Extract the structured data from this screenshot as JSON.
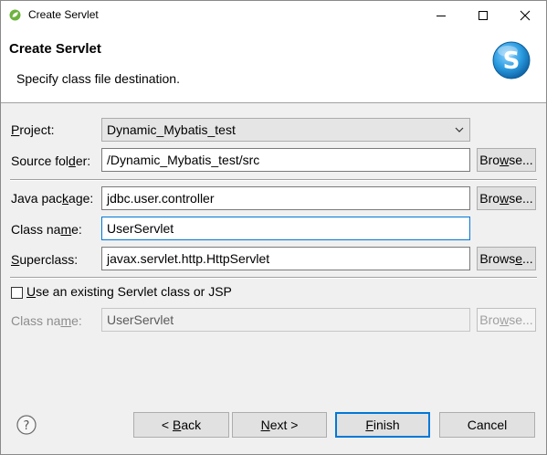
{
  "window": {
    "title": "Create Servlet",
    "minimize_icon": "minimize-icon",
    "maximize_icon": "maximize-icon",
    "close_icon": "close-icon"
  },
  "banner": {
    "title": "Create Servlet",
    "description": "Specify class file destination.",
    "logo_icon": "spring-s-logo"
  },
  "form": {
    "project": {
      "label_pre": "",
      "label_mn": "P",
      "label_post": "roject:",
      "value": "Dynamic_Mybatis_test"
    },
    "source_folder": {
      "label_pre": "Source fol",
      "label_mn": "d",
      "label_post": "er:",
      "value": "/Dynamic_Mybatis_test/src",
      "browse_pre": "Bro",
      "browse_mn": "w",
      "browse_post": "se..."
    },
    "java_package": {
      "label_pre": "Java pac",
      "label_mn": "k",
      "label_post": "age:",
      "value": "jdbc.user.controller",
      "browse_pre": "Bro",
      "browse_mn": "w",
      "browse_post": "se..."
    },
    "class_name": {
      "label_pre": "Class na",
      "label_mn": "m",
      "label_post": "e:",
      "value": "UserServlet"
    },
    "superclass": {
      "label_pre": "",
      "label_mn": "S",
      "label_post": "uperclass:",
      "value": "javax.servlet.http.HttpServlet",
      "browse_pre": "Brows",
      "browse_mn": "e",
      "browse_post": "..."
    },
    "existing": {
      "checked": false,
      "label_pre": "",
      "label_mn": "U",
      "label_post": "se an existing Servlet class or JSP"
    },
    "existing_class": {
      "label_pre": "Class na",
      "label_mn": "m",
      "label_post": "e:",
      "value": "UserServlet",
      "browse_pre": "Bro",
      "browse_mn": "w",
      "browse_post": "se..."
    }
  },
  "footer": {
    "help_icon": "help-icon",
    "back": {
      "pre": "< ",
      "mn": "B",
      "post": "ack"
    },
    "next": {
      "pre": "",
      "mn": "N",
      "post": "ext >"
    },
    "finish": {
      "pre": "",
      "mn": "F",
      "post": "inish"
    },
    "cancel": "Cancel"
  },
  "colors": {
    "accent": "#0078d7",
    "dialog_bg": "#f0f0f0",
    "spring_green": "#6db33f"
  }
}
